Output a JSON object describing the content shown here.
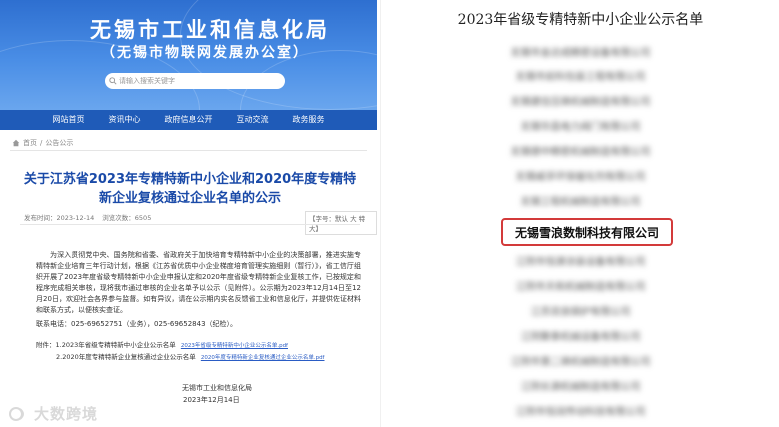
{
  "site": {
    "title": "无锡市工业和信息化局",
    "subtitle": "（无锡市物联网发展办公室）",
    "search_placeholder": "请输入搜索关键字"
  },
  "nav": {
    "items": [
      "网站首页",
      "资讯中心",
      "政府信息公开",
      "互动交流",
      "政务服务"
    ]
  },
  "breadcrumb": {
    "home": "首页",
    "sep": "/",
    "current": "公告公示"
  },
  "article": {
    "title": "关于江苏省2023年专精特新中小企业和2020年度专精特新企业复核通过企业名单的公示",
    "publish_date": "发布时间：2023-12-14",
    "views": "浏览次数：6505",
    "font_control": "【字号：默认 大 特大】",
    "body": "为深入贯彻党中央、国务院和省委、省政府关于加快培育专精特新中小企业的决策部署，推进实施专精特新企业培育三年行动计划，根据《江苏省优质中小企业梯度培育管理实施细则（暂行）》，省工信厅组织开展了2023年度省级专精特新中小企业申报认定和2020年度省级专精特新企业复核工作，已按规定和程序完成相关审核，现将我市通过审核的企业名单予以公示（见附件）。公示期为2023年12月14日至12月20日，欢迎社会各界参与监督。如有异议，请在公示期内实名反馈省工业和信息化厅，并提供佐证材料和联系方式，以便核实查证。",
    "contact": "联系电话：025-69652751（业务），025-69652843（纪检）。",
    "attachment1_label": "附件：1.2023年省级专精特新中小企业公示名单",
    "attachment1_link": "2023年省级专精特新中小企业公示名单.pdf",
    "attachment2_label": "2.2020年度专精特新企业复核通过企业公示名单",
    "attachment2_link": "2020年度专精特新企业复核通过企业公示名单.pdf",
    "sign_org": "无锡市工业和信息化局",
    "sign_date": "2023年12月14日"
  },
  "watermark": {
    "text": "大数跨境"
  },
  "list": {
    "title": "2023年省级专精特新中小企业公示名单",
    "highlighted": "无锡雪浪数制科技有限公司",
    "blurred": [
      "无锡市金达成精密设备有限公司",
      "无锡市前科包装工程有限公司",
      "无锡建信压铸机械制造有限公司",
      "无锡华昌电力阀门有限公司",
      "无锡德中精密机械制造有限公司",
      "无锡威孚环保催化剂有限公司",
      "无锡工程机械制造有限公司",
      "江阴市恒源涂装设备有限公司",
      "江阴市天和机械制造有限公司",
      "江苏双良锅炉有限公司",
      "江阴聚泰机械设备有限公司",
      "江阴市第二铸机械制造有限公司",
      "江阴长源机械制造有限公司",
      "江阴市恒润传动科技有限公司"
    ]
  },
  "colors": {
    "banner_blue": "#2e6fd0",
    "nav_blue": "#1f5bb8",
    "title_blue": "#1a4aa8",
    "highlight_red": "#d33a3a"
  }
}
